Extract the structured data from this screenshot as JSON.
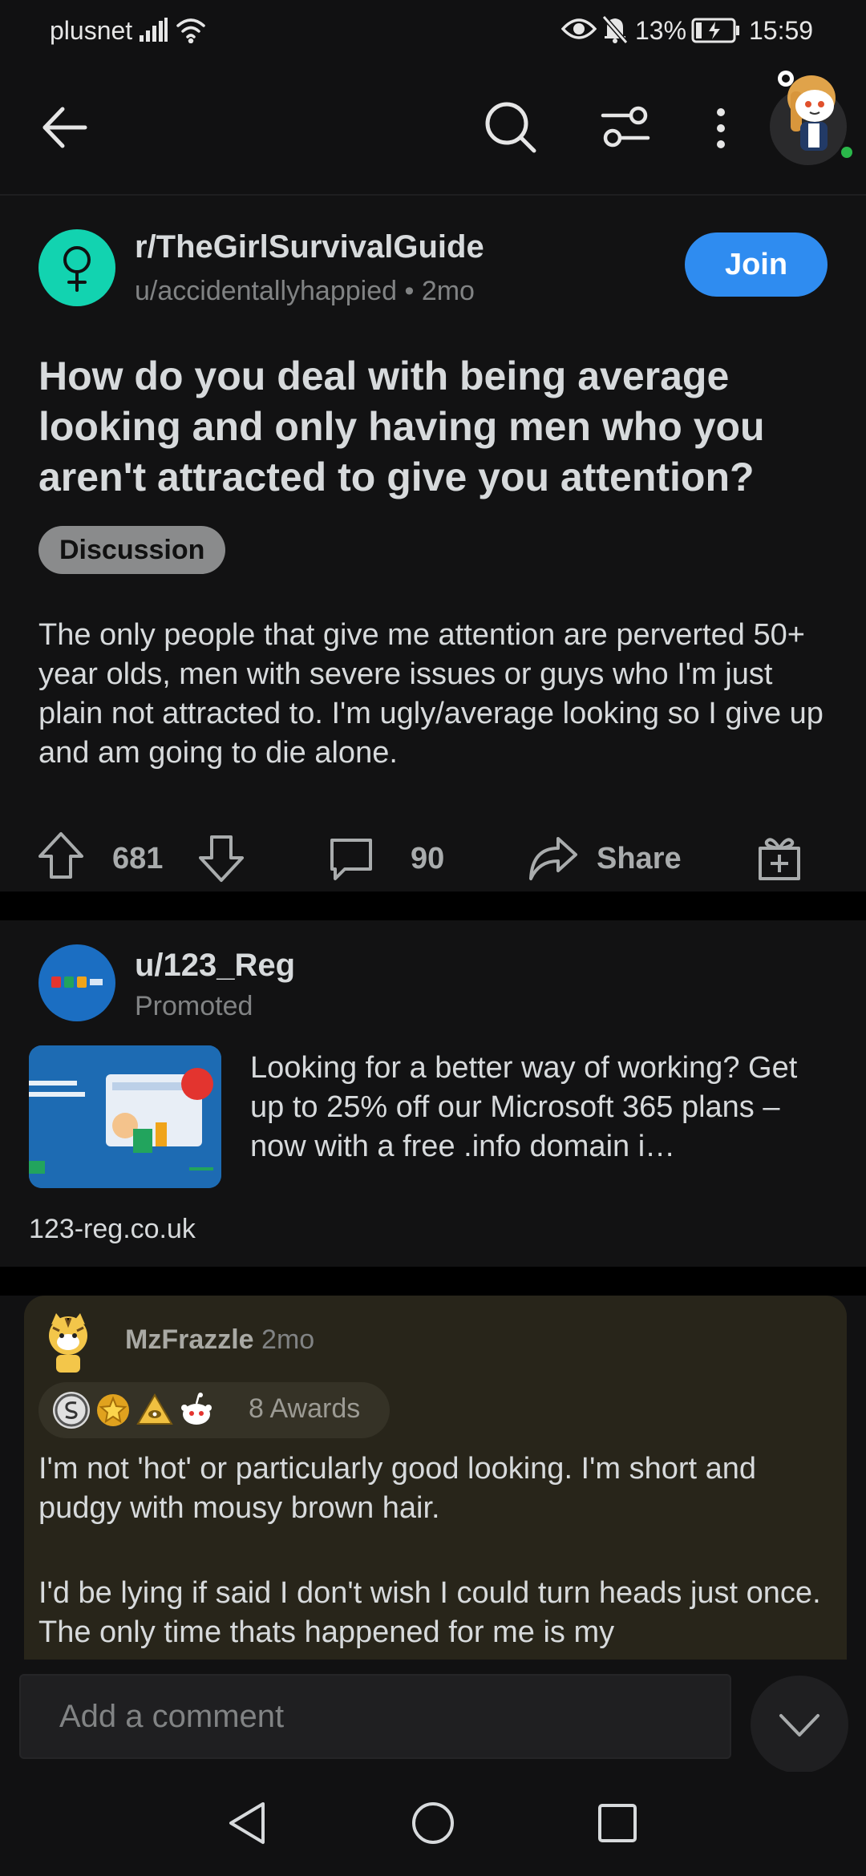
{
  "status_bar": {
    "carrier": "plusnet",
    "battery": "13%",
    "time": "15:59"
  },
  "top_nav": {
    "icons": [
      "back-arrow-icon",
      "search-icon",
      "sort-filter-icon",
      "more-vert-icon",
      "user-avatar"
    ]
  },
  "post": {
    "subreddit": "r/TheGirlSurvivalGuide",
    "author": "u/accidentallyhappied",
    "age": "2mo",
    "join_label": "Join",
    "title": "How do you deal with being average looking and only having men who you aren't attracted to give you attention?",
    "flair": "Discussion",
    "body": "The only people that give me attention are perverted 50+ year olds, men with severe issues or guys who I'm just plain not attracted to. I'm ugly/average looking so I give up and am going to die alone.",
    "votes": "681",
    "comments": "90",
    "share_label": "Share"
  },
  "ad": {
    "user": "u/123_Reg",
    "promoted_label": "Promoted",
    "text": "Looking for a better way of working? Get up to 25% off our Microsoft 365 plans – now with a free .info domain i…",
    "domain": "123-reg.co.uk",
    "brand_colors": {
      "blue": "#1b6ec2",
      "red": "#e3342f",
      "green": "#22a45d",
      "orange": "#f0a41a"
    }
  },
  "comment": {
    "author": "MzFrazzle",
    "age": "2mo",
    "awards_label": "8 Awards",
    "paragraphs": [
      "I'm not 'hot' or particularly good looking. I'm short and pudgy with mousy brown hair.",
      "I'd be lying if said I don't wish I could turn heads just once. The only time thats happened for me is my"
    ]
  },
  "composer": {
    "placeholder": "Add a comment"
  },
  "colors": {
    "background": "#111112",
    "join_button": "#2f8cf0",
    "subreddit_icon": "#12d3b0",
    "comment_highlight": "#28251a",
    "online_dot": "#2ab84a"
  }
}
